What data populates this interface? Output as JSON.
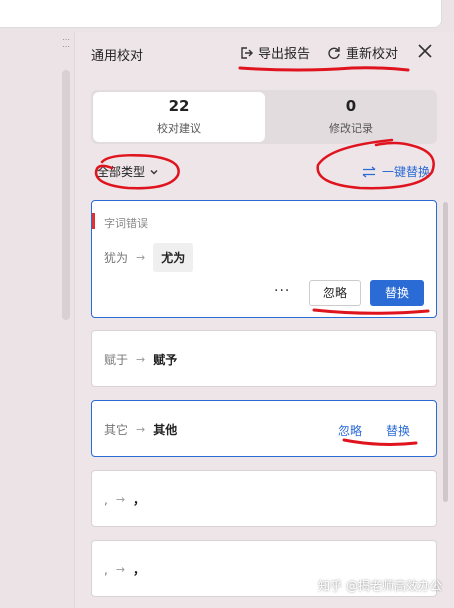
{
  "panel": {
    "title": "通用校对",
    "export_label": "导出报告",
    "recheck_label": "重新校对"
  },
  "stats": {
    "suggestions_count": "22",
    "suggestions_label": "校对建议",
    "edits_count": "0",
    "edits_label": "修改记录"
  },
  "filter": {
    "label": "全部类型"
  },
  "replace_all_label": "一键替换",
  "cards": [
    {
      "category": "字词错误",
      "original": "犹为",
      "suggestion": "尤为",
      "more_label": "···",
      "ignore_label": "忽略",
      "replace_label": "替换"
    },
    {
      "original": "赋于",
      "suggestion": "赋予"
    },
    {
      "original": "其它",
      "suggestion": "其他",
      "ignore_label": "忽略",
      "replace_label": "替换"
    },
    {
      "original": ",",
      "suggestion": "，"
    },
    {
      "original": ",",
      "suggestion": "，"
    }
  ],
  "watermark": "知乎 @揭老师高效办公",
  "colors": {
    "accent": "#2b6bd6",
    "error_tag": "#dd3333",
    "annotation": "#e0141e"
  }
}
